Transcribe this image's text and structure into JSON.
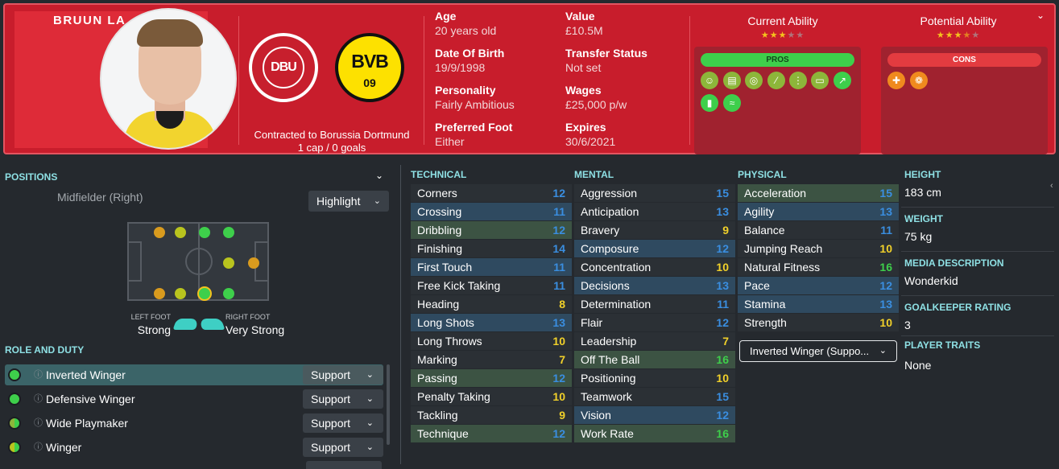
{
  "header": {
    "player_name": "BRUUN LA",
    "contract_text": "Contracted to Borussia Dortmund",
    "caps_text": "1 cap / 0 goals",
    "dbu_crest_text": "DBU",
    "bvb_crest_top": "BVB",
    "bvb_crest_bottom": "09",
    "info_col1": [
      {
        "label": "Age",
        "value": "20 years old"
      },
      {
        "label": "Date Of Birth",
        "value": "19/9/1998"
      },
      {
        "label": "Personality",
        "value": "Fairly Ambitious"
      },
      {
        "label": "Preferred Foot",
        "value": "Either"
      }
    ],
    "info_col2": [
      {
        "label": "Value",
        "value": "£10.5M"
      },
      {
        "label": "Transfer Status",
        "value": "Not set"
      },
      {
        "label": "Wages",
        "value": "£25,000 p/w"
      },
      {
        "label": "Expires",
        "value": "30/6/2021"
      }
    ],
    "current_ability": {
      "label": "Current Ability",
      "stars": 3,
      "max": 5
    },
    "potential_ability": {
      "label": "Potential Ability",
      "stars": 3.5,
      "max": 5
    },
    "pros_label": "PROS",
    "cons_label": "CONS"
  },
  "positions": {
    "title": "POSITIONS",
    "position_text": "Midfielder (Right)",
    "highlight_label": "Highlight",
    "left_foot_label": "LEFT FOOT",
    "left_foot_value": "Strong",
    "right_foot_label": "RIGHT FOOT",
    "right_foot_value": "Very Strong"
  },
  "role_duty": {
    "title": "ROLE AND DUTY",
    "roles": [
      {
        "name": "Inverted Winger",
        "duty": "Support"
      },
      {
        "name": "Defensive Winger",
        "duty": "Support"
      },
      {
        "name": "Wide Playmaker",
        "duty": "Support"
      },
      {
        "name": "Winger",
        "duty": "Support"
      }
    ]
  },
  "technical": {
    "title": "TECHNICAL",
    "attributes": [
      {
        "name": "Corners",
        "value": "12"
      },
      {
        "name": "Crossing",
        "value": "11"
      },
      {
        "name": "Dribbling",
        "value": "12"
      },
      {
        "name": "Finishing",
        "value": "14"
      },
      {
        "name": "First Touch",
        "value": "11"
      },
      {
        "name": "Free Kick Taking",
        "value": "11"
      },
      {
        "name": "Heading",
        "value": "8"
      },
      {
        "name": "Long Shots",
        "value": "13"
      },
      {
        "name": "Long Throws",
        "value": "10"
      },
      {
        "name": "Marking",
        "value": "7"
      },
      {
        "name": "Passing",
        "value": "12"
      },
      {
        "name": "Penalty Taking",
        "value": "10"
      },
      {
        "name": "Tackling",
        "value": "9"
      },
      {
        "name": "Technique",
        "value": "12"
      }
    ]
  },
  "mental": {
    "title": "MENTAL",
    "attributes": [
      {
        "name": "Aggression",
        "value": "15"
      },
      {
        "name": "Anticipation",
        "value": "13"
      },
      {
        "name": "Bravery",
        "value": "9"
      },
      {
        "name": "Composure",
        "value": "12"
      },
      {
        "name": "Concentration",
        "value": "10"
      },
      {
        "name": "Decisions",
        "value": "13"
      },
      {
        "name": "Determination",
        "value": "11"
      },
      {
        "name": "Flair",
        "value": "12"
      },
      {
        "name": "Leadership",
        "value": "7"
      },
      {
        "name": "Off The Ball",
        "value": "16"
      },
      {
        "name": "Positioning",
        "value": "10"
      },
      {
        "name": "Teamwork",
        "value": "15"
      },
      {
        "name": "Vision",
        "value": "12"
      },
      {
        "name": "Work Rate",
        "value": "16"
      }
    ]
  },
  "physical": {
    "title": "PHYSICAL",
    "attributes": [
      {
        "name": "Acceleration",
        "value": "15"
      },
      {
        "name": "Agility",
        "value": "13"
      },
      {
        "name": "Balance",
        "value": "11"
      },
      {
        "name": "Jumping Reach",
        "value": "10"
      },
      {
        "name": "Natural Fitness",
        "value": "16"
      },
      {
        "name": "Pace",
        "value": "12"
      },
      {
        "name": "Stamina",
        "value": "13"
      },
      {
        "name": "Strength",
        "value": "10"
      }
    ],
    "role_select_value": "Inverted Winger (Suppo..."
  },
  "details": {
    "height_label": "HEIGHT",
    "height_value": "183 cm",
    "weight_label": "WEIGHT",
    "weight_value": "75 kg",
    "media_label": "MEDIA DESCRIPTION",
    "media_value": "Wonderkid",
    "gk_label": "GOALKEEPER RATING",
    "gk_value": "3",
    "traits_label": "PLAYER TRAITS",
    "traits_value": "None"
  },
  "colors": {
    "header_red": "#c81d2c",
    "accent_teal": "#8ee0e4",
    "pros_green": "#3ecf4b",
    "cons_red": "#e33b40",
    "val_blue": "#3a8ee0",
    "val_green": "#3ecf4b",
    "val_yellow": "#f0d02a",
    "val_orange": "#f0a020"
  }
}
